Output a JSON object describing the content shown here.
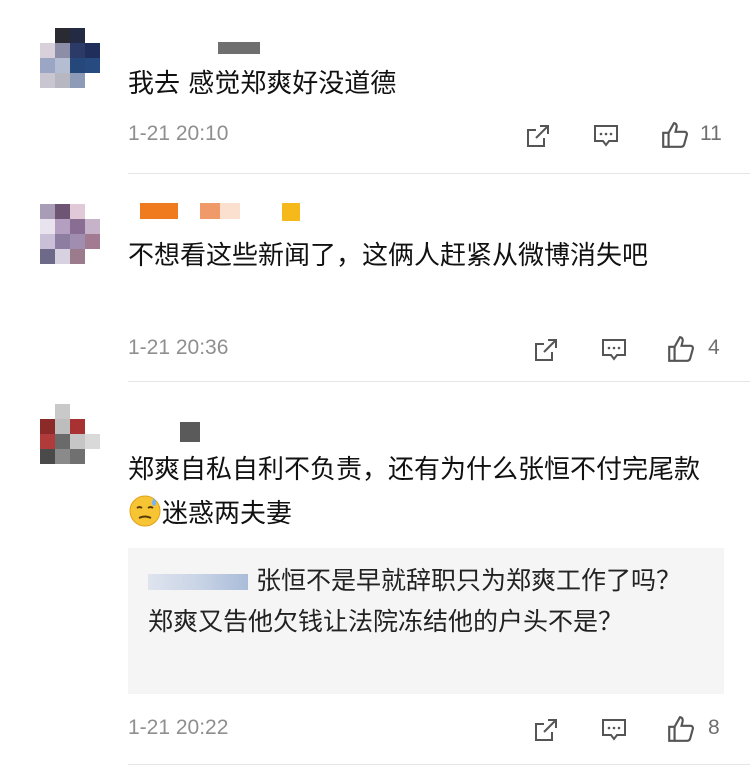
{
  "comments": [
    {
      "text": "我去 感觉郑爽好没道德",
      "time": "1-21 20:10",
      "likes": "11"
    },
    {
      "text": "不想看这些新闻了，这俩人赶紧从微博消失吧",
      "time": "1-21 20:36",
      "likes": "4"
    },
    {
      "text_before_emoji": "郑爽自私自利不负责，还有为什么张恒不付完尾款",
      "text_after_emoji": "迷惑两夫妻",
      "emoji": "sweat-emoji",
      "reply": {
        "text": "张恒不是早就辞职只为郑爽工作了吗？郑爽又告他欠钱让法院冻结他的户头不是？"
      },
      "time": "1-21 20:22",
      "likes": "8"
    }
  ],
  "icons": {
    "share": "share-icon",
    "comment": "comment-icon",
    "like": "thumbs-up-icon"
  },
  "colors": {
    "text": "#111111",
    "meta": "#8f8f8f",
    "icon": "#555555",
    "divider": "#e6e6e6",
    "reply_bg": "#f5f5f5"
  }
}
